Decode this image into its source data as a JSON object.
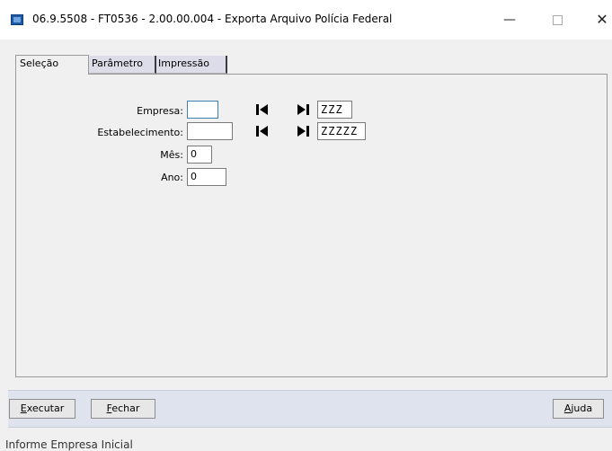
{
  "window": {
    "title": "06.9.5508 - FT0536 - 2.00.00.004 - Exporta Arquivo Polícia Federal",
    "minimize_glyph": "—",
    "close_glyph": "✕"
  },
  "tabs": [
    {
      "label": "Seleção",
      "active": true
    },
    {
      "label": "Parâmetro",
      "active": false
    },
    {
      "label": "Impressão",
      "active": false
    }
  ],
  "form": {
    "empresa": {
      "label": "Empresa:",
      "initial": "",
      "final": "ZZZ"
    },
    "estabelecimento": {
      "label": "Estabelecimento:",
      "initial": "",
      "final": "ZZZZZ"
    },
    "mes": {
      "label": "Mês:",
      "value": "0"
    },
    "ano": {
      "label": "Ano:",
      "value": "0"
    }
  },
  "buttons": {
    "executar": {
      "mnemonic": "E",
      "rest": "xecutar"
    },
    "fechar": {
      "mnemonic": "F",
      "rest": "echar"
    },
    "ajuda": {
      "mnemonic": "A",
      "rest": "juda"
    }
  },
  "status_bar": {
    "text": "Informe Empresa Inicial"
  },
  "icons": {
    "first": "skip-first-icon",
    "last": "skip-last-icon"
  }
}
